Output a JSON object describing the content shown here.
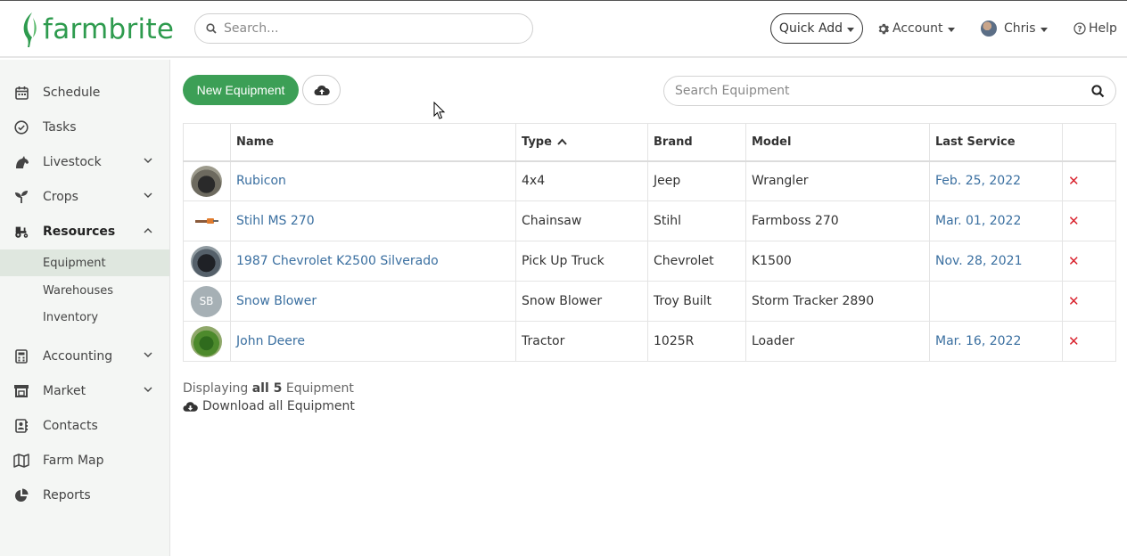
{
  "header": {
    "brand": "farmbrite",
    "search_placeholder": "Search...",
    "quick_add": "Quick Add",
    "account": "Account",
    "user": "Chris",
    "help": "Help"
  },
  "sidebar": {
    "items": [
      {
        "label": "Schedule",
        "icon": "calendar-icon"
      },
      {
        "label": "Tasks",
        "icon": "check-circle-icon"
      },
      {
        "label": "Livestock",
        "icon": "horse-icon"
      },
      {
        "label": "Crops",
        "icon": "seedling-icon"
      },
      {
        "label": "Resources",
        "icon": "tractor-icon"
      },
      {
        "label": "Accounting",
        "icon": "calculator-icon"
      },
      {
        "label": "Market",
        "icon": "store-icon"
      },
      {
        "label": "Contacts",
        "icon": "address-book-icon"
      },
      {
        "label": "Farm Map",
        "icon": "map-icon"
      },
      {
        "label": "Reports",
        "icon": "pie-chart-icon"
      }
    ],
    "subitems": [
      "Equipment",
      "Warehouses",
      "Inventory"
    ]
  },
  "toolbar": {
    "new_equipment": "New Equipment",
    "search_placeholder": "Search Equipment"
  },
  "table": {
    "columns": [
      "Name",
      "Type",
      "Brand",
      "Model",
      "Last Service"
    ],
    "rows": [
      {
        "name": "Rubicon",
        "type": "4x4",
        "brand": "Jeep",
        "model": "Wrangler",
        "last_service": "Feb. 25, 2022",
        "thumb": "photo"
      },
      {
        "name": "Stihl MS 270",
        "type": "Chainsaw",
        "brand": "Stihl",
        "model": "Farmboss 270",
        "last_service": "Mar. 01, 2022",
        "thumb": "photo"
      },
      {
        "name": "1987 Chevrolet K2500 Silverado",
        "type": "Pick Up Truck",
        "brand": "Chevrolet",
        "model": "K1500",
        "last_service": "Nov. 28, 2021",
        "thumb": "photo"
      },
      {
        "name": "Snow Blower",
        "type": "Snow Blower",
        "brand": "Troy Built",
        "model": "Storm Tracker 2890",
        "last_service": "",
        "thumb": "SB"
      },
      {
        "name": "John Deere",
        "type": "Tractor",
        "brand": "1025R",
        "model": "Loader",
        "last_service": "Mar. 16, 2022",
        "thumb": "photo"
      }
    ]
  },
  "footer": {
    "displaying_prefix": "Displaying",
    "displaying_count": "all 5",
    "displaying_suffix": "Equipment",
    "download": "Download all Equipment"
  },
  "colors": {
    "brand_green": "#3c9f56",
    "link_blue": "#3a6fa0",
    "delete_red": "#d9232e"
  }
}
